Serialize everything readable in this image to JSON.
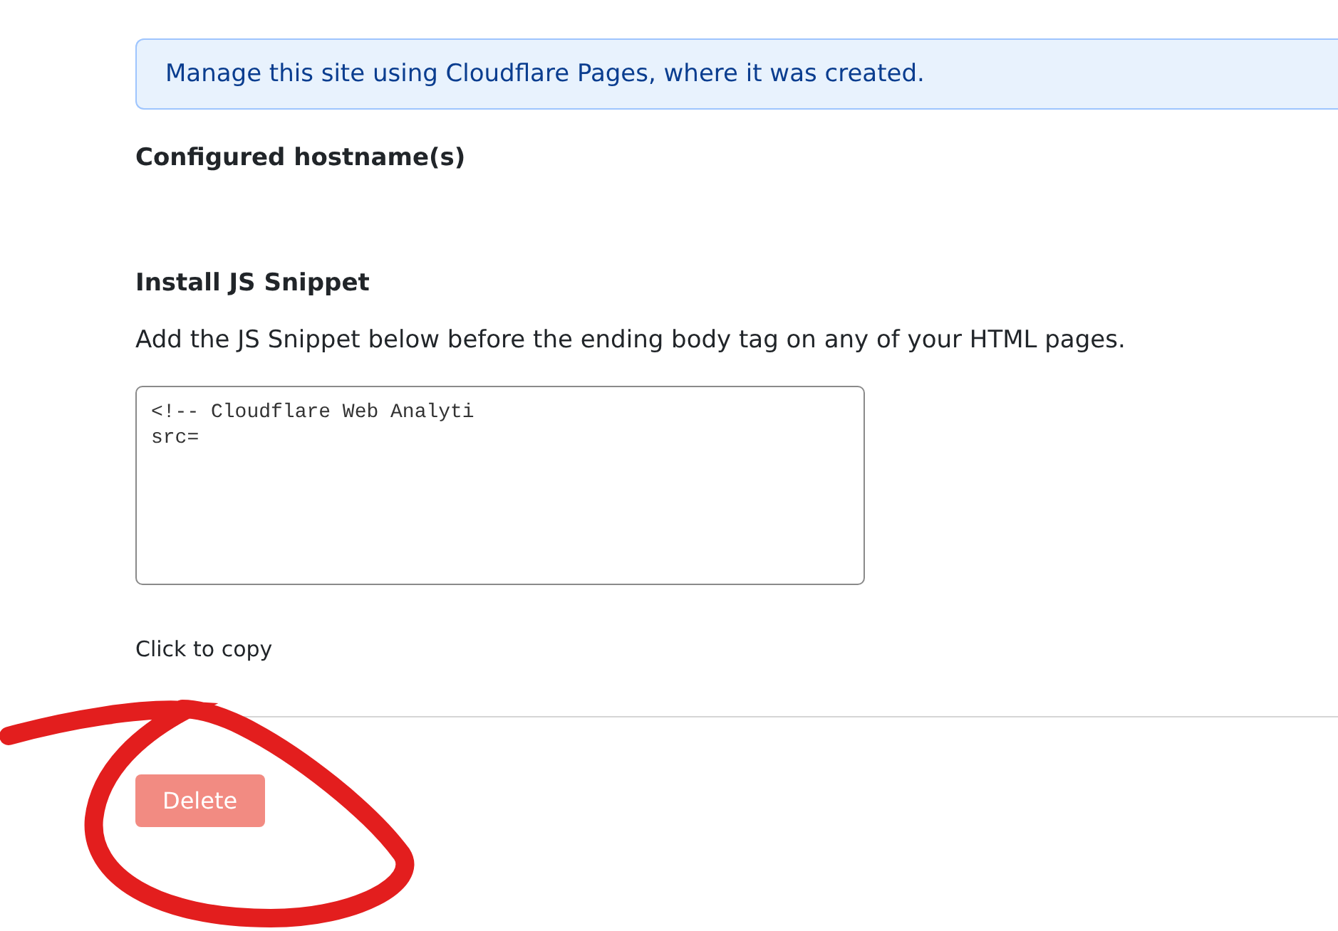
{
  "notice": "Manage this site using Cloudflare Pages, where it was created.",
  "hostnames": {
    "title": "Configured hostname(s)"
  },
  "snippet": {
    "title": "Install JS Snippet",
    "description": "Add the JS Snippet below before the ending body tag on any of your HTML pages.",
    "lines": [
      "<!-- Cloudflare Web Analyti",
      "src="
    ],
    "copy_hint": "Click to copy"
  },
  "delete_button": {
    "label": "Delete",
    "disabled": true
  }
}
